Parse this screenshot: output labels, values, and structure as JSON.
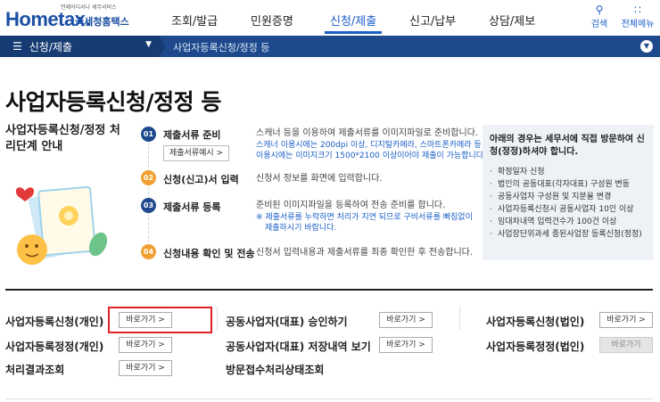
{
  "header": {
    "logo_tagline": "언제어디서나 세무서비스",
    "logo_text": "Hometax.",
    "logo_sub": "국세청홈택스",
    "nav": [
      "조회/발급",
      "민원증명",
      "신청/제출",
      "신고/납부",
      "상담/제보"
    ],
    "active_nav": "신청/제출",
    "search_label": "검색",
    "allmenu_label": "전체메뉴"
  },
  "breadcrumb": {
    "menu_label": "신청/제출",
    "current": "사업자등록신청/정정 등"
  },
  "page": {
    "title": "사업자등록신청/정정 등",
    "steps_title": "사업자등록신청/정정 처리단계 안내"
  },
  "steps": [
    {
      "num": "01",
      "name": "제출서류 준비",
      "desc": "스캐너 등을 이용하여 제출서류를 이미지파일로 준비합니다.",
      "note1": "스캐너 이용시에는 200dpi 이상, 디지털카메라, 스마트폰카메라 등",
      "note2": "이용시에는 이미지크기 1500*2100 이상이어야 제출이 가능합니다.",
      "button": "제출서류예시 >"
    },
    {
      "num": "02",
      "name": "신청(신고)서 입력",
      "desc": "신청서 정보를 화면에 입력합니다."
    },
    {
      "num": "03",
      "name": "제출서류 등록",
      "desc": "준비된 이미지파일을 등록하여 전송 준비를 합니다.",
      "note1": "※ 제출서류를 누락하면 처리가 지연 되므로 구비서류를 빠짐없이",
      "note2": "제출하시기 바랍니다."
    },
    {
      "num": "04",
      "name": "신청내용 확인 및 전송",
      "desc": "신청서 입력내용과 제출서류를 최종 확인한 후 전송합니다."
    }
  ],
  "info_box": {
    "heading": "아래의 경우는 세무서에 직접 방문하여 신청(정정)하셔야 합니다.",
    "items": [
      "확정일자 신청",
      "법인의 공동대표(각자대표) 구성원 변동",
      "공동사업자 구성원 및 지분율 변경",
      "사업자등록신청시 공동사업자 10인 이상",
      "임대차내역 입력건수가 100건 이상",
      "사업장단위과세 종된사업장 등록신청(정정)"
    ]
  },
  "services": {
    "go_label": "바로가기 >",
    "go_label_disabled": "바로가기",
    "col1": [
      "사업자등록신청(개인)",
      "사업자등록정정(개인)",
      "처리결과조회"
    ],
    "col2": [
      "공동사업자(대표) 승인하기",
      "공동사업자(대표) 저장내역 보기",
      "방문접수처리상태조회"
    ],
    "col3": [
      "사업자등록신청(법인)",
      "사업자등록정정(법인)"
    ]
  },
  "colors": {
    "brand_blue": "#1a4fa3",
    "breadcrumb_bg": "#1e4a8d",
    "step1": "#1e4a8d",
    "step2": "#f0a030",
    "step3": "#1e4a8d",
    "step4": "#f0a030",
    "highlight": "#e02020"
  }
}
